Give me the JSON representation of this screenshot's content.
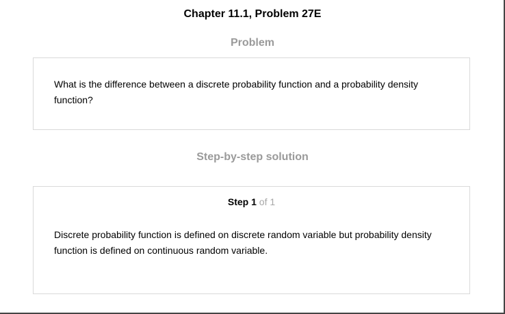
{
  "page": {
    "title": "Chapter 11.1, Problem 27E"
  },
  "problem": {
    "heading": "Problem",
    "text": "What is the difference between a discrete probability function and a probability density function?"
  },
  "solution": {
    "heading": "Step-by-step solution",
    "step": {
      "word": "Step",
      "number": "1",
      "of_total": "of 1"
    },
    "text": "Discrete probability function is defined on discrete random variable but probability density function is defined on continuous random variable."
  }
}
